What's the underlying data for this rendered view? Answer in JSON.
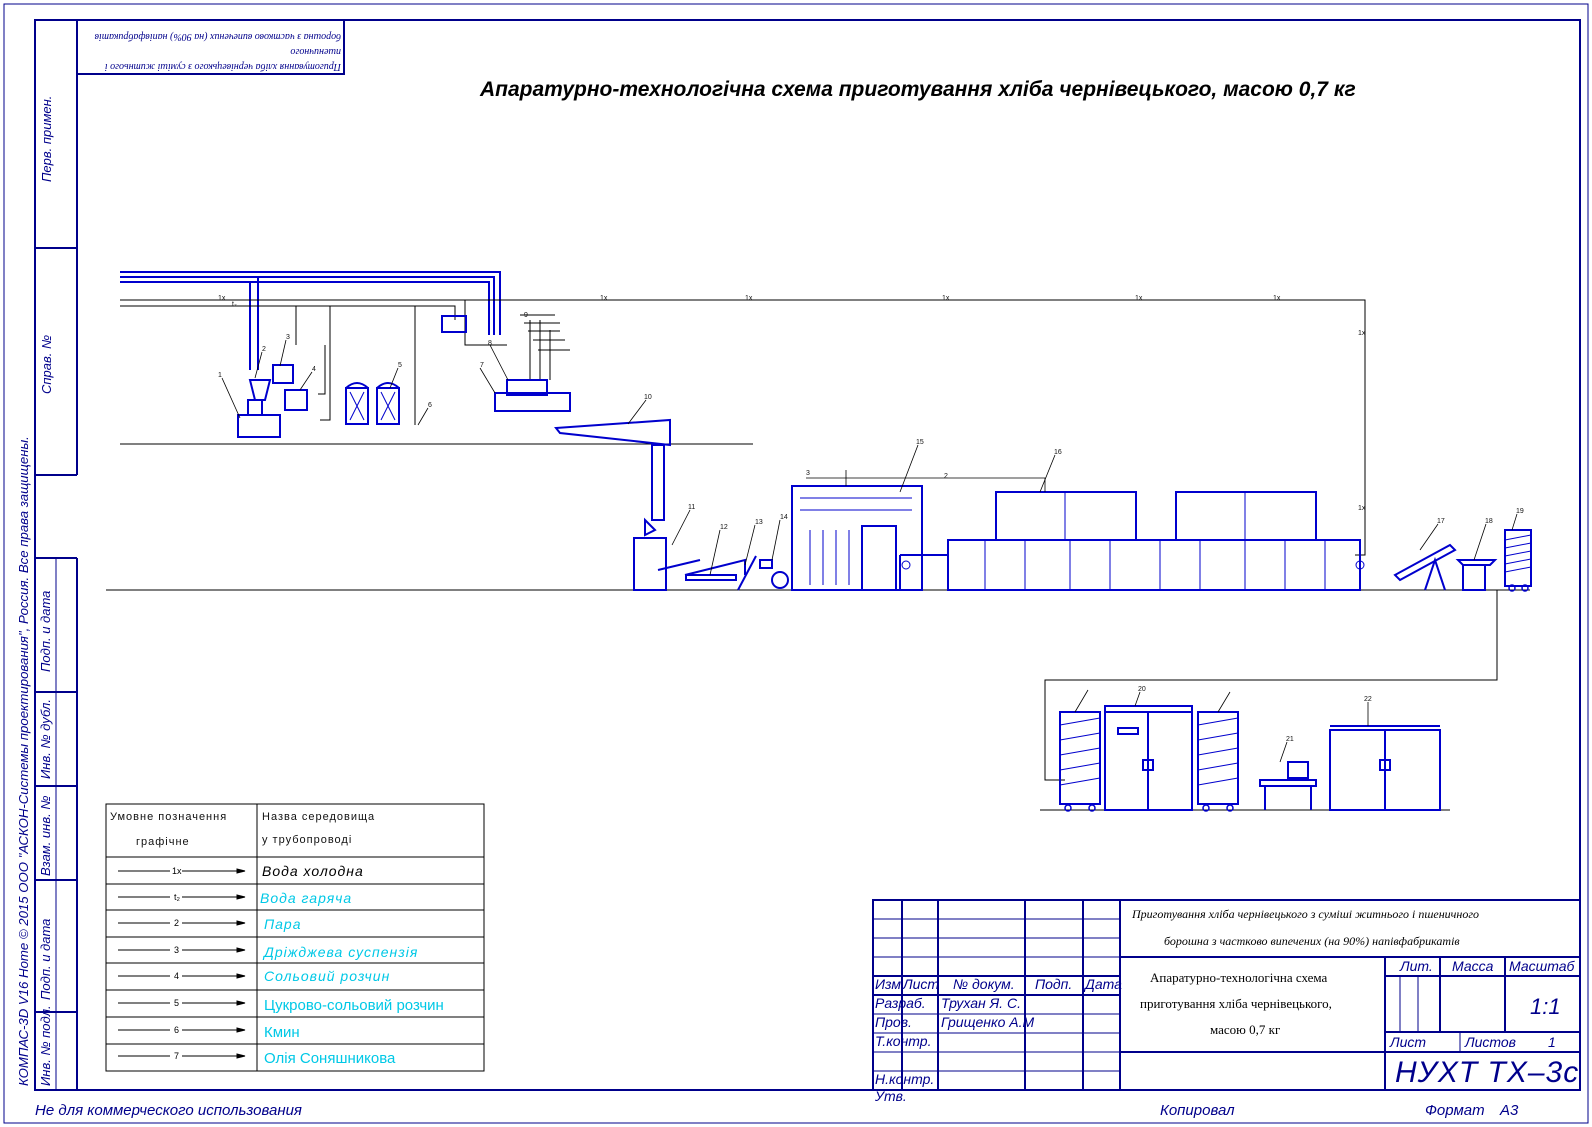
{
  "title": "Апаратурно-технологічна схема приготування хліба чернівецького,  масою 0,7 кг",
  "stamp_lines": [
    "Приготування хліба чернівецького з суміші житнього і пшеничного",
    "борошна з частково випечених (на 90%) напівфабрикатів"
  ],
  "side_frame": {
    "perv_primen": "Перв. примен.",
    "sprav_no": "Справ. №",
    "podp_data_1": "Подп. и дата",
    "inv_dubl": "Инв. № дубл.",
    "vzam_inv": "Взам. инв. №",
    "podp_data_2": "Подп. и дата",
    "inv_podl": "Инв. № подл."
  },
  "copyright": "КОМПАС-3D V16 Home  © 2015 ООО \"АСКОН-Системы проектирования\", Россия. Все права защищены.",
  "legend": {
    "header_col1_line1": "Умовне позначення",
    "header_col1_line2": "графічне",
    "header_col2_line1": "Назва середовища",
    "header_col2_line2": "у трубопроводі",
    "rows": [
      {
        "code": "1х",
        "name": "Вода холодна",
        "color": "#000000"
      },
      {
        "code": "t₂",
        "name": "Вода гаряча",
        "color": "#00c8e6"
      },
      {
        "code": "2",
        "name": "Пара",
        "color": "#00c8e6"
      },
      {
        "code": "3",
        "name": "Дріжджева суспензія",
        "color": "#00c8e6"
      },
      {
        "code": "4",
        "name": "Сольовий розчин",
        "color": "#00c8e6"
      },
      {
        "code": "5",
        "name": "Цукрово-сольовий розчин",
        "color": "#00c8e6"
      },
      {
        "code": "6",
        "name": "Кмин",
        "color": "#00c8e6"
      },
      {
        "code": "7",
        "name": "Олія Соняшникова",
        "color": "#00c8e6"
      }
    ]
  },
  "title_block": {
    "doc_title_line1": "Приготування хліба чернівецького з суміші житнього і пшеничного",
    "doc_title_line2": "борошна з частково випечених (на 90%) напівфабрикатів",
    "drawing_name_line1": "Апаратурно-технологічна схема",
    "drawing_name_line2": "приготування хліба чернівецького,",
    "drawing_name_line3": "масою 0,7 кг",
    "izm": "Изм.",
    "list": "Лист",
    "doc_no": "№ докум.",
    "podp": "Подп.",
    "data": "Дата",
    "razrab": "Разраб.",
    "razrab_name": "Трухан Я. С.",
    "prov": "Пров.",
    "prov_name": "Грищенко А.М",
    "tkontr": "Т.контр.",
    "nkontr": "Н.контр.",
    "utv": "Утв.",
    "lit": "Лит.",
    "massa": "Масса",
    "masshtab": "Масштаб",
    "scale": "1:1",
    "list_label": "Лист",
    "listov_label": "Листов",
    "listov": "1",
    "designation": "НУХТ ТХ–3с"
  },
  "footer": {
    "left": "Не для коммерческого использования",
    "copied": "Копировал",
    "format_label": "Формат",
    "format": "А3"
  },
  "pipe_labels": {
    "cold_water": "1х",
    "hot_water": "t₂",
    "steam": "2",
    "yeast": "3"
  },
  "equipment_numbers": [
    "1",
    "2",
    "3",
    "4",
    "5",
    "6",
    "7",
    "8",
    "9",
    "10",
    "11",
    "12",
    "13",
    "14",
    "15",
    "16",
    "17",
    "18",
    "19",
    "20",
    "21",
    "22"
  ],
  "colors": {
    "frame": "#00008b",
    "equipment": "#0000cd",
    "text_cyan": "#00c8e6",
    "line": "#000000"
  }
}
